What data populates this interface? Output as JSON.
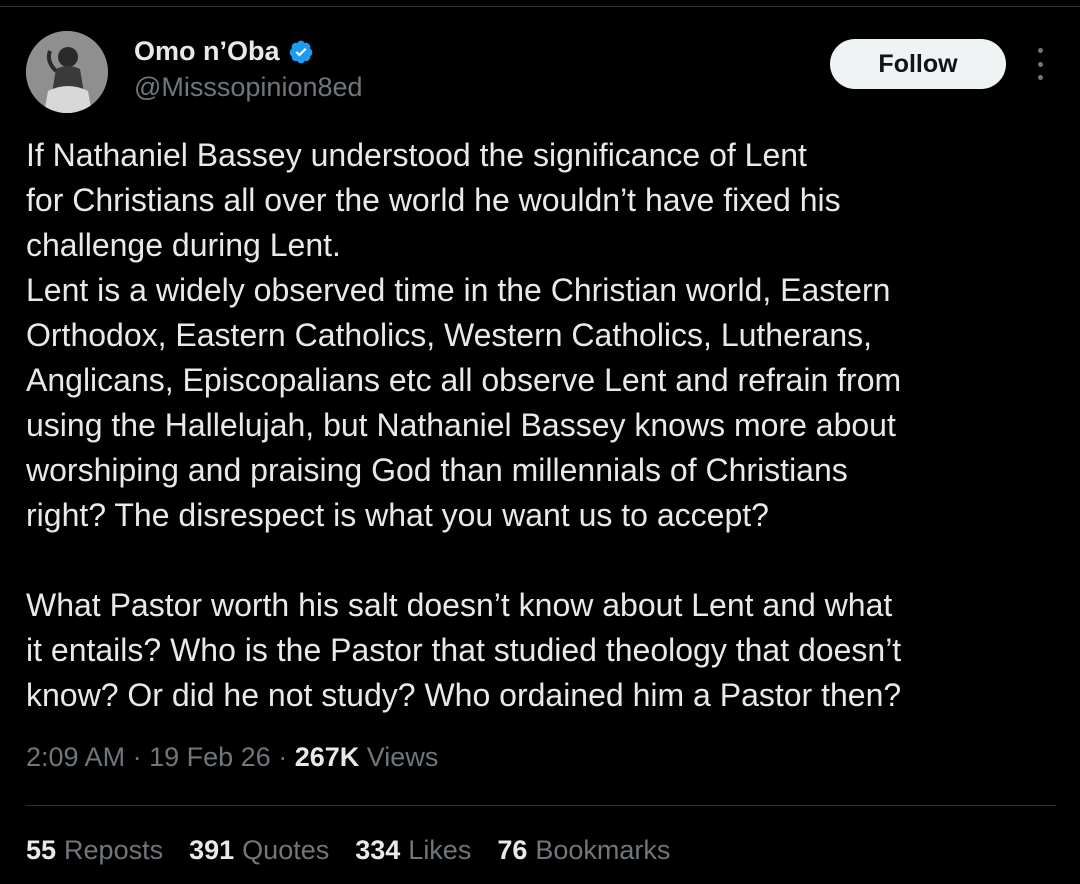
{
  "author": {
    "name": "Omo n’Oba",
    "handle": "@Misssopinion8ed",
    "verified_icon": "verified-badge-icon",
    "verified_color": "#1d9bf0"
  },
  "follow_label": "Follow",
  "tweet": {
    "lines_1": [
      "If Nathaniel Bassey understood the significance of Lent",
      "for Christians all over the world he wouldn’t have fixed his",
      "challenge during Lent.",
      "Lent is a widely observed time in the Christian world, Eastern",
      "Orthodox, Eastern Catholics, Western Catholics, Lutherans,",
      "Anglicans, Episcopalians etc all observe Lent and refrain from",
      "using the Hallelujah, but Nathaniel Bassey knows more about",
      "worshiping and praising God than millennials of Christians",
      "right? The disrespect is what you want us to accept?"
    ],
    "lines_2": [
      "What Pastor worth his salt doesn’t know about Lent and what",
      "it entails? Who is the Pastor that studied theology that doesn’t",
      "know? Or did he not study? Who ordained him a Pastor then?"
    ]
  },
  "meta": {
    "time": "2:09 AM",
    "date": "19 Feb 26",
    "views_count": "267K",
    "views_label": "Views",
    "separator": "·"
  },
  "stats": {
    "reposts_count": "55",
    "reposts_label": "Reposts",
    "quotes_count": "391",
    "quotes_label": "Quotes",
    "likes_count": "334",
    "likes_label": "Likes",
    "bookmarks_count": "76",
    "bookmarks_label": "Bookmarks"
  },
  "colors": {
    "background": "#000000",
    "text": "#e7e9ea",
    "secondary": "#71767b",
    "divider": "#2f3336"
  }
}
